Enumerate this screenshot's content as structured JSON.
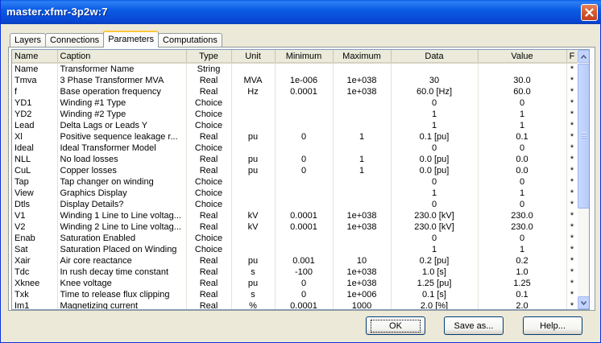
{
  "window": {
    "title": "master.xfmr-3p2w:7"
  },
  "tabs": [
    {
      "label": "Layers",
      "active": false
    },
    {
      "label": "Connections",
      "active": false
    },
    {
      "label": "Parameters",
      "active": true
    },
    {
      "label": "Computations",
      "active": false
    }
  ],
  "grid": {
    "columns": [
      "Name",
      "Caption",
      "Type",
      "Unit",
      "Minimum",
      "Maximum",
      "Data",
      "Value",
      "F"
    ],
    "rows": [
      [
        "Name",
        "Transformer Name",
        "String",
        "",
        "",
        "",
        "",
        "",
        "*"
      ],
      [
        "Tmva",
        "3 Phase Transformer MVA",
        "Real",
        "MVA",
        "1e-006",
        "1e+038",
        "30",
        "30.0",
        "*"
      ],
      [
        "f",
        "Base operation frequency",
        "Real",
        "Hz",
        "0.0001",
        "1e+038",
        "60.0 [Hz]",
        "60.0",
        "*"
      ],
      [
        "YD1",
        "Winding #1 Type",
        "Choice",
        "",
        "",
        "",
        "0",
        "0",
        "*"
      ],
      [
        "YD2",
        "Winding #2 Type",
        "Choice",
        "",
        "",
        "",
        "1",
        "1",
        "*"
      ],
      [
        "Lead",
        "Delta Lags or Leads Y",
        "Choice",
        "",
        "",
        "",
        "1",
        "1",
        "*"
      ],
      [
        "Xl",
        "Positive sequence leakage r...",
        "Real",
        "pu",
        "0",
        "1",
        "0.1 [pu]",
        "0.1",
        "*"
      ],
      [
        "Ideal",
        "Ideal Transformer Model",
        "Choice",
        "",
        "",
        "",
        "0",
        "0",
        "*"
      ],
      [
        "NLL",
        "No load losses",
        "Real",
        "pu",
        "0",
        "1",
        "0.0 [pu]",
        "0.0",
        "*"
      ],
      [
        "CuL",
        "Copper losses",
        "Real",
        "pu",
        "0",
        "1",
        "0.0 [pu]",
        "0.0",
        "*"
      ],
      [
        "Tap",
        "Tap changer on winding",
        "Choice",
        "",
        "",
        "",
        "0",
        "0",
        "*"
      ],
      [
        "View",
        "Graphics Display",
        "Choice",
        "",
        "",
        "",
        "1",
        "1",
        "*"
      ],
      [
        "Dtls",
        "Display Details?",
        "Choice",
        "",
        "",
        "",
        "0",
        "0",
        "*"
      ],
      [
        "V1",
        "Winding 1 Line to Line voltag...",
        "Real",
        "kV",
        "0.0001",
        "1e+038",
        "230.0 [kV]",
        "230.0",
        "*"
      ],
      [
        "V2",
        "Winding 2 Line to Line voltag...",
        "Real",
        "kV",
        "0.0001",
        "1e+038",
        "230.0 [kV]",
        "230.0",
        "*"
      ],
      [
        "Enab",
        "Saturation Enabled",
        "Choice",
        "",
        "",
        "",
        "0",
        "0",
        "*"
      ],
      [
        "Sat",
        "Saturation Placed on Winding",
        "Choice",
        "",
        "",
        "",
        "1",
        "1",
        "*"
      ],
      [
        "Xair",
        "Air core reactance",
        "Real",
        "pu",
        "0.001",
        "10",
        "0.2 [pu]",
        "0.2",
        "*"
      ],
      [
        "Tdc",
        "In rush decay time constant",
        "Real",
        "s",
        "-100",
        "1e+038",
        "1.0 [s]",
        "1.0",
        "*"
      ],
      [
        "Xknee",
        "Knee voltage",
        "Real",
        "pu",
        "0",
        "1e+038",
        "1.25 [pu]",
        "1.25",
        "*"
      ],
      [
        "Txk",
        "Time to release flux clipping",
        "Real",
        "s",
        "0",
        "1e+006",
        "0.1 [s]",
        "0.1",
        "*"
      ],
      [
        "Im1",
        "Magnetizing current",
        "Real",
        "%",
        "0.0001",
        "1000",
        "2.0 [%]",
        "2.0",
        "*"
      ]
    ]
  },
  "buttons": {
    "ok": "OK",
    "save_as": "Save as...",
    "help": "Help..."
  },
  "icons": {
    "close": "close-icon",
    "scroll_up": "arrow-up-icon",
    "scroll_down": "arrow-down-icon"
  }
}
